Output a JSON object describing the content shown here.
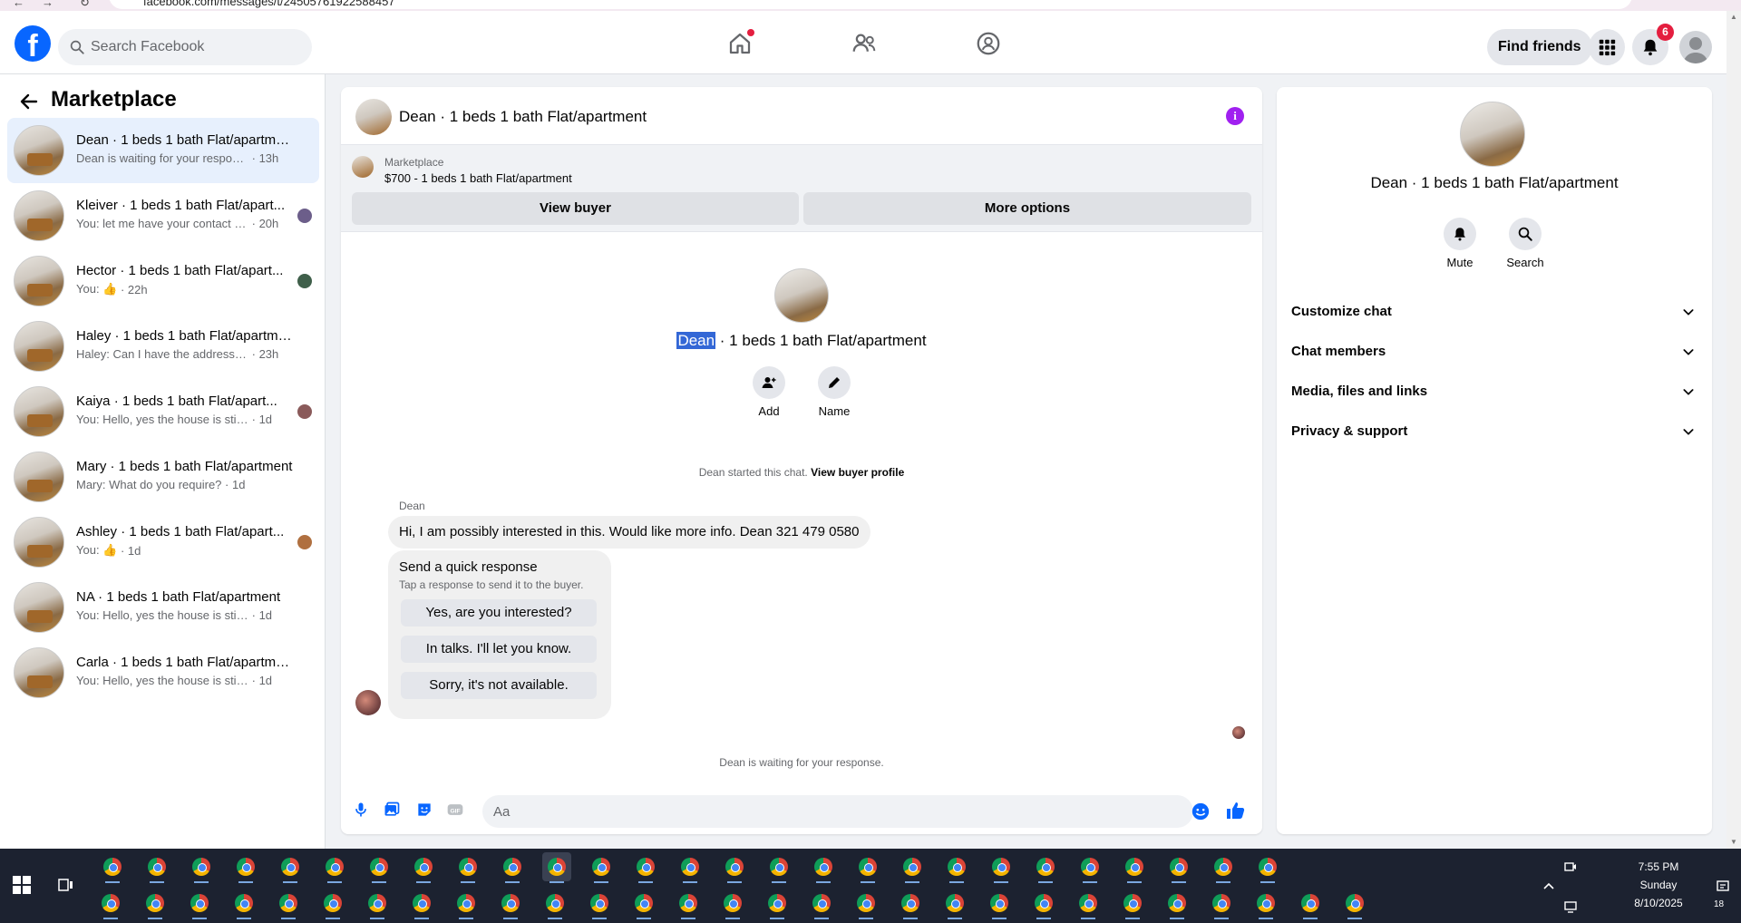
{
  "browser": {
    "url": "facebook.com/messages/t/24505761922588457"
  },
  "topnav": {
    "search_placeholder": "Search Facebook",
    "find_friends": "Find friends",
    "notifications_count": "6"
  },
  "sidebar": {
    "title": "Marketplace",
    "chats": [
      {
        "name": "Dean · 1 beds 1 bath Flat/apartment",
        "msg": "Dean is waiting for your response.",
        "time": "· 13h",
        "active": true
      },
      {
        "name": "Kleiver · 1 beds 1 bath Flat/apart...",
        "msg": "You: let me have your contact nu...",
        "time": "· 20h"
      },
      {
        "name": "Hector · 1 beds 1 bath Flat/apart...",
        "msg": "You: 👍",
        "time": "· 22h"
      },
      {
        "name": "Haley · 1 beds 1 bath Flat/apartment",
        "msg": "Haley: Can I have the address so I ca...",
        "time": "· 23h"
      },
      {
        "name": "Kaiya · 1 beds 1 bath Flat/apart...",
        "msg": "You: Hello, yes the house is still ava...",
        "time": "· 1d"
      },
      {
        "name": "Mary · 1 beds 1 bath Flat/apartment",
        "msg": "Mary: What do you require?",
        "time": "· 1d"
      },
      {
        "name": "Ashley · 1 beds 1 bath Flat/apart...",
        "msg": "You: 👍",
        "time": "· 1d"
      },
      {
        "name": "NA · 1 beds 1 bath Flat/apartment",
        "msg": "You: Hello, yes the house is still availa...",
        "time": "· 1d"
      },
      {
        "name": "Carla · 1 beds 1 bath Flat/apartment",
        "msg": "You: Hello, yes the house is still availa...",
        "time": "· 1d"
      }
    ]
  },
  "conversation": {
    "header_title": "Dean · 1 beds 1 bath Flat/apartment",
    "marketplace_label": "Marketplace",
    "listing": "$700 - 1 beds 1 bath Flat/apartment",
    "view_buyer": "View buyer",
    "more_options": "More options",
    "name_highlight": "Dean",
    "name_rest": " · 1 beds 1 bath Flat/apartment",
    "add_label": "Add",
    "name_label": "Name",
    "started_text": "Dean started this chat.",
    "view_buyer_profile": "View buyer profile",
    "sender": "Dean",
    "message": "Hi, I am possibly interested in this. Would like more info. Dean 321 479 0580",
    "quick_title": "Send a quick response",
    "quick_sub": "Tap a response to send it to the buyer.",
    "quick_responses": [
      "Yes, are you interested?",
      "In talks. I'll let you know.",
      "Sorry, it's not available."
    ],
    "waiting": "Dean is waiting for your response.",
    "composer_placeholder": "Aa"
  },
  "details": {
    "name": "Dean · 1 beds 1 bath Flat/apartment",
    "mute": "Mute",
    "search": "Search",
    "sections": [
      "Customize chat",
      "Chat members",
      "Media, files and links",
      "Privacy & support"
    ]
  },
  "taskbar": {
    "time": "7:55 PM",
    "day": "Sunday",
    "date": "8/10/2025",
    "notif_count": "18"
  },
  "colors": {
    "accent": "#0866ff",
    "badge": "#e41e3f",
    "info": "#a020f0",
    "highlight": "#3367d6"
  }
}
